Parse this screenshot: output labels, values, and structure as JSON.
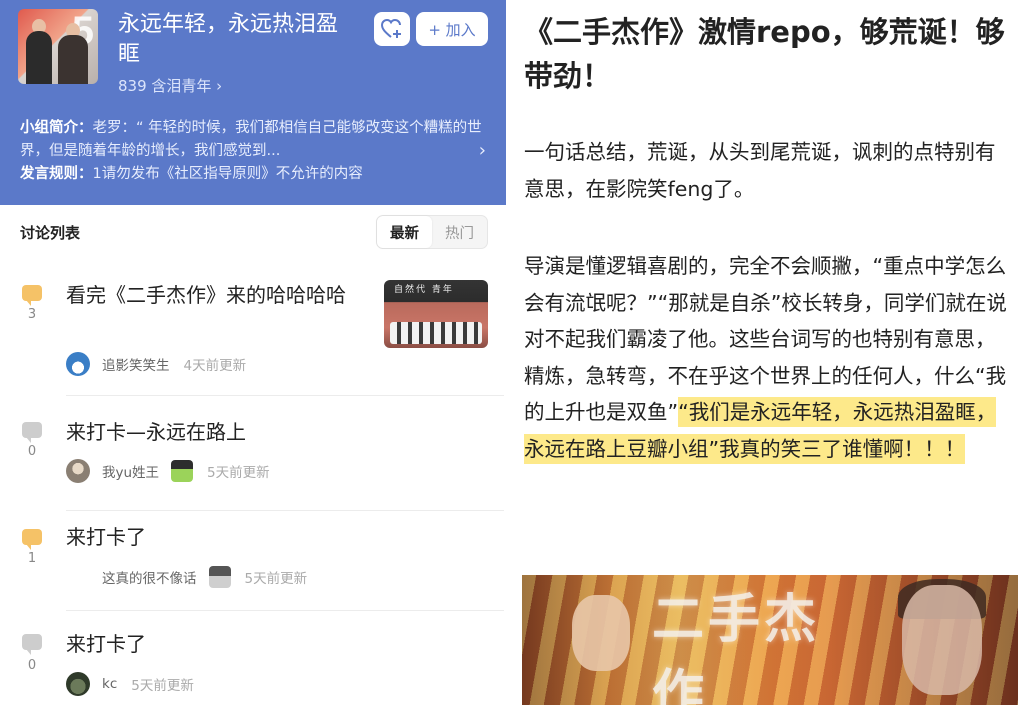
{
  "group": {
    "title": "永远年轻，永远热泪盈眶",
    "members": "839 含泪青年 ›",
    "join_label": "+ 加入",
    "intro_label": "小组简介：",
    "intro_text": "老罗：“ 年轻的时候，我们都相信自己能够改变这个糟糕的世界，但是随着年龄的增长，我们感觉到...",
    "rule_label": "发言规则：",
    "rule_text": "1请勿发布《社区指导原则》不允许的内容",
    "avatar_number": "5"
  },
  "list": {
    "title": "讨论列表",
    "sort_newest": "最新",
    "sort_hot": "热门",
    "thumb_banner": "自然代 青年"
  },
  "topics": [
    {
      "count": "3",
      "title": "看完《二手杰作》来的哈哈哈哈",
      "author": "追影笑笑生",
      "time": "4天前更新"
    },
    {
      "count": "0",
      "title": "来打卡—永远在路上",
      "author": "我yu姓王",
      "time": "5天前更新"
    },
    {
      "count": "1",
      "title": "来打卡了",
      "author": "这真的很不像话",
      "time": "5天前更新"
    },
    {
      "count": "0",
      "title": "来打卡了",
      "author": "kc",
      "time": "5天前更新"
    }
  ],
  "article": {
    "title": "《二手杰作》激情repo，够荒诞！够带劲！",
    "p1": "一句话总结，荒诞，从头到尾荒诞，讽刺的点特别有意思，在影院笑feng了。",
    "p2": "导演是懂逻辑喜剧的，完全不会顺撇，“重点中学怎么会有流氓呢？”“那就是自杀”校长转身，同学们就在说对不起我们霸凌了他。这些台词写的也特别有意思，精炼，急转弯，不在乎这个世界上的任何人，什么“我的上升也是双鱼”",
    "p2_highlight": "“我们是永远年轻，永远热泪盈眶，永远在路上豆瓣小组”我真的笑三了谁懂啊！！！",
    "poster_text": "二手杰作"
  },
  "colors": {
    "header_bg": "#5b79c9",
    "highlight": "#fde98a",
    "bubble_hot": "#f5c267",
    "bubble_cold": "#cdcdcd"
  }
}
